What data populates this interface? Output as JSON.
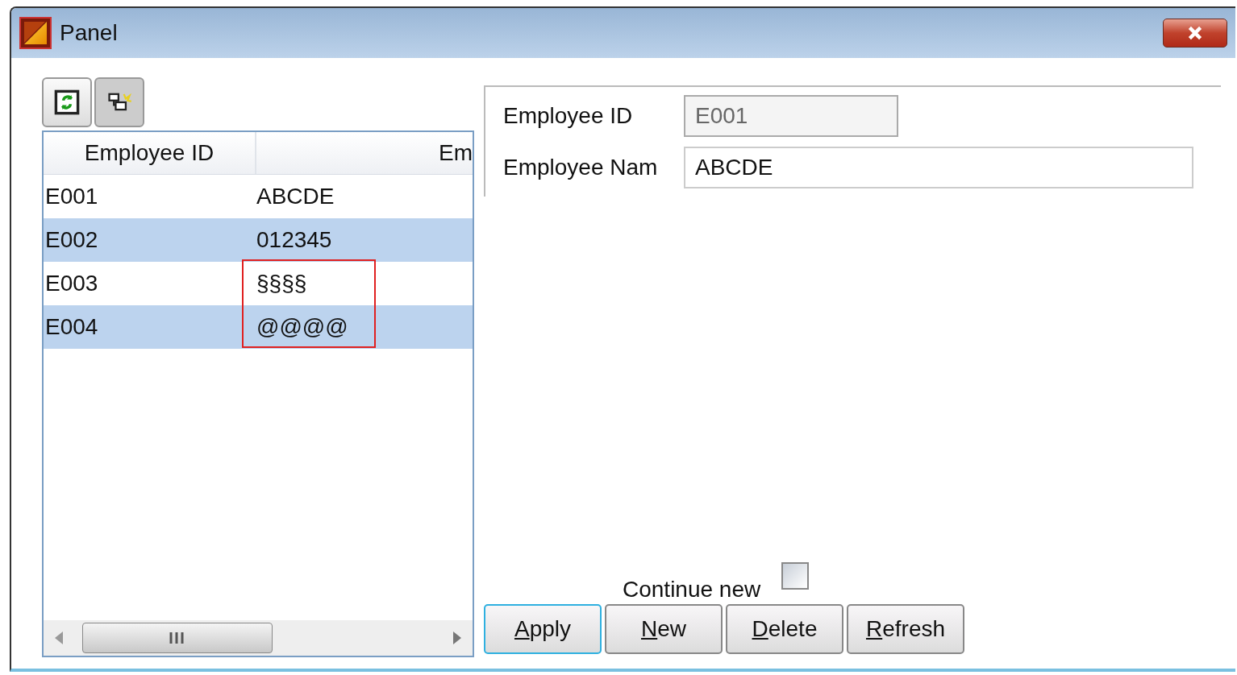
{
  "window": {
    "title": "Panel"
  },
  "grid": {
    "columns": [
      "Employee ID",
      "Em"
    ],
    "rows": [
      {
        "id": "E001",
        "name": "ABCDE",
        "highlighted": false,
        "marked": false
      },
      {
        "id": "E002",
        "name": "012345",
        "highlighted": true,
        "marked": false
      },
      {
        "id": "E003",
        "name": "§§§§",
        "highlighted": false,
        "marked": true
      },
      {
        "id": "E004",
        "name": "@@@@",
        "highlighted": true,
        "marked": true
      }
    ]
  },
  "form": {
    "fields": [
      {
        "label": "Employee ID",
        "value": "E001",
        "disabled": true
      },
      {
        "label": "Employee Nam",
        "value": "ABCDE",
        "disabled": false
      }
    ],
    "continue_new": {
      "label": "Continue new",
      "checked": false
    },
    "buttons": [
      {
        "key": "A",
        "rest": "pply",
        "focused": true
      },
      {
        "key": "N",
        "rest": "ew",
        "focused": false
      },
      {
        "key": "D",
        "rest": "elete",
        "focused": false
      },
      {
        "key": "R",
        "rest": "efresh",
        "focused": false
      }
    ]
  }
}
